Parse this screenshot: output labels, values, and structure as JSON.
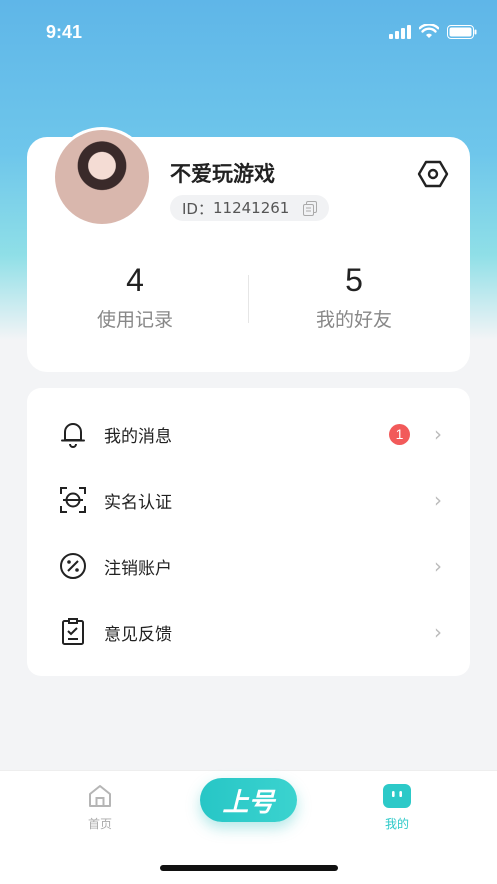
{
  "status_bar": {
    "time": "9:41"
  },
  "profile": {
    "nickname": "不爱玩游戏",
    "id_prefix": "ID：",
    "id_value": "11241261",
    "stats": [
      {
        "value": "4",
        "label": "使用记录"
      },
      {
        "value": "5",
        "label": "我的好友"
      }
    ]
  },
  "menu": {
    "items": [
      {
        "label": "我的消息",
        "icon": "bell-icon",
        "badge": "1"
      },
      {
        "label": "实名认证",
        "icon": "face-scan-icon"
      },
      {
        "label": "注销账户",
        "icon": "percent-circle-icon"
      },
      {
        "label": "意见反馈",
        "icon": "clipboard-check-icon"
      }
    ],
    "chevron": "›"
  },
  "tab_bar": {
    "home_label": "首页",
    "center_label": "上号",
    "mine_label": "我的"
  },
  "colors": {
    "accent": "#2cc9c8",
    "badge": "#f25a5a",
    "gradient_top": "#5fb6e8"
  }
}
